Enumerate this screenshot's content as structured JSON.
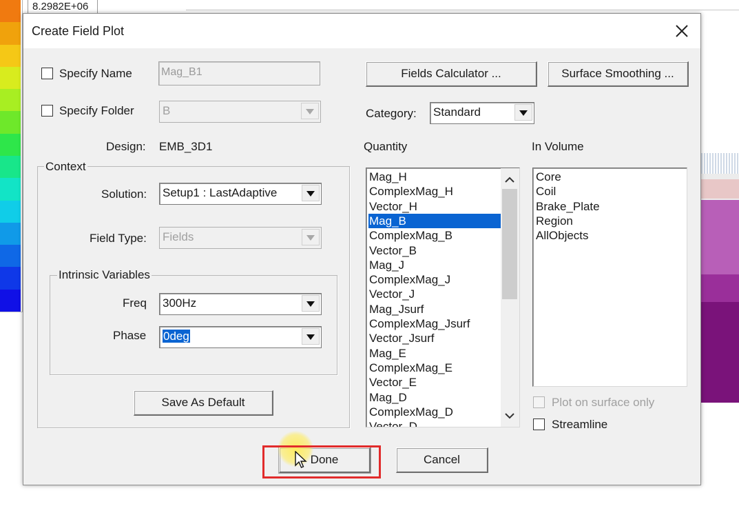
{
  "colors": {
    "legend": [
      "#f07a10",
      "#f0a20c",
      "#f5c816",
      "#d8ec1e",
      "#a8ee22",
      "#6ee82a",
      "#2ee64a",
      "#18e68a",
      "#12e4c6",
      "#10cde8",
      "#109ae8",
      "#0f68e6",
      "#0f38e8",
      "#1010e6"
    ],
    "selection": "#0a64d2",
    "highlight": "#e12b2b"
  },
  "background": {
    "legend_max_value": "8.2982E+06"
  },
  "dialog": {
    "title": "Create Field Plot",
    "close_icon": "close-icon",
    "specify_name": {
      "label": "Specify Name",
      "value": "Mag_B1",
      "checked": false
    },
    "specify_folder": {
      "label": "Specify Folder",
      "value": "B",
      "checked": false
    },
    "design": {
      "label": "Design:",
      "value": "EMB_3D1"
    },
    "context": {
      "title": "Context",
      "solution": {
        "label": "Solution:",
        "value": "Setup1 : LastAdaptive"
      },
      "field_type": {
        "label": "Field Type:",
        "value": "Fields"
      },
      "intrinsic": {
        "title": "Intrinsic Variables",
        "freq": {
          "label": "Freq",
          "value": "300Hz"
        },
        "phase": {
          "label": "Phase",
          "value": "0deg"
        }
      },
      "save_default_label": "Save As Default"
    },
    "fields_calculator_label": "Fields Calculator ...",
    "surface_smoothing_label": "Surface Smoothing ...",
    "category": {
      "label": "Category:",
      "value": "Standard"
    },
    "quantity": {
      "title": "Quantity",
      "selected": "Mag_B",
      "items": [
        "Mag_H",
        "ComplexMag_H",
        "Vector_H",
        "Mag_B",
        "ComplexMag_B",
        "Vector_B",
        "Mag_J",
        "ComplexMag_J",
        "Vector_J",
        "Mag_Jsurf",
        "ComplexMag_Jsurf",
        "Vector_Jsurf",
        "Mag_E",
        "ComplexMag_E",
        "Vector_E",
        "Mag_D",
        "ComplexMag_D",
        "Vector_D"
      ]
    },
    "in_volume": {
      "title": "In Volume",
      "items": [
        "Core",
        "Coil",
        "Brake_Plate",
        "Region",
        "AllObjects"
      ]
    },
    "plot_on_surface_only": {
      "label": "Plot on surface only",
      "checked": false
    },
    "streamline": {
      "label": "Streamline",
      "checked": false
    },
    "done_label": "Done",
    "cancel_label": "Cancel"
  }
}
